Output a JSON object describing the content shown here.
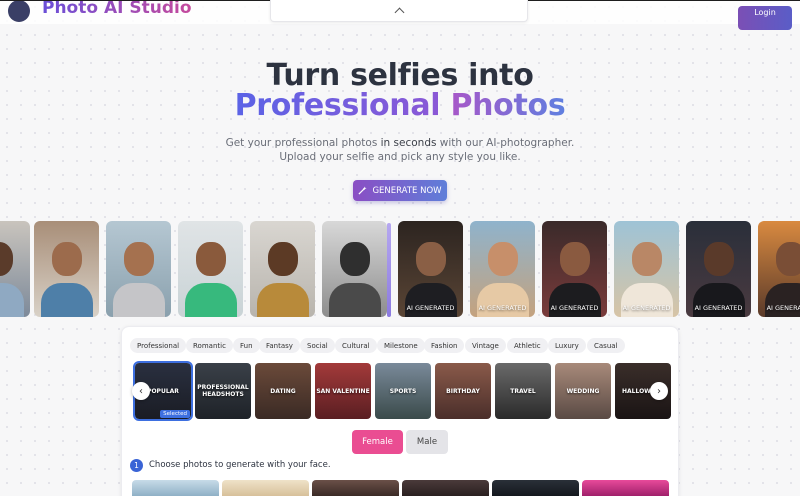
{
  "header": {
    "brand": "Photo AI Studio",
    "login_label": "Login",
    "collapse_icon": "chevron-up-icon"
  },
  "hero": {
    "line1": "Turn selfies into",
    "line2_word1": "Professional",
    "line2_word2": "Photos",
    "subtitle_pre": "Get your professional photos ",
    "subtitle_strong": "in seconds",
    "subtitle_post": " with our AI-photographer.",
    "subtitle2": "Upload your selfie and pick any style you like.",
    "cta_label": "GENERATE NOW",
    "cta_icon": "magic-wand-icon"
  },
  "strip": {
    "ai_label": "AI GENERATED",
    "photos": [
      {
        "kind": "original"
      },
      {
        "kind": "original"
      },
      {
        "kind": "original"
      },
      {
        "kind": "original"
      },
      {
        "kind": "original"
      },
      {
        "kind": "original"
      },
      {
        "kind": "generated",
        "label": "AI GENERATED"
      },
      {
        "kind": "generated",
        "label": "AI GENERATED"
      },
      {
        "kind": "generated",
        "label": "AI GENERATED"
      },
      {
        "kind": "generated",
        "label": "AI GENERATED"
      },
      {
        "kind": "generated",
        "label": "AI GENERATED"
      },
      {
        "kind": "generated",
        "label": "AI GENERATED"
      }
    ]
  },
  "categories": [
    "Professional",
    "Romantic",
    "Fun",
    "Fantasy",
    "Social",
    "Cultural",
    "Milestone",
    "Fashion",
    "Vintage",
    "Athletic",
    "Luxury",
    "Casual"
  ],
  "styles": [
    {
      "label": "POPULAR",
      "selected": true
    },
    {
      "label": "PROFESSIONAL HEADSHOTS",
      "selected": false
    },
    {
      "label": "DATING",
      "selected": false
    },
    {
      "label": "SAN VALENTINE",
      "selected": false
    },
    {
      "label": "SPORTS",
      "selected": false
    },
    {
      "label": "BIRTHDAY",
      "selected": false
    },
    {
      "label": "TRAVEL",
      "selected": false
    },
    {
      "label": "WEDDING",
      "selected": false
    },
    {
      "label": "HALLOWEEN",
      "selected": false
    }
  ],
  "selected_badge": "Selected",
  "gender": {
    "female": "Female",
    "male": "Male",
    "active": "female"
  },
  "step": {
    "number": "1",
    "text": "Choose photos to generate with your face."
  },
  "colors": {
    "accent": "#ea4d92",
    "primary": "#3a64d6",
    "brand_gradient_start": "#8a4ec4",
    "brand_gradient_end": "#5f7ed9"
  }
}
